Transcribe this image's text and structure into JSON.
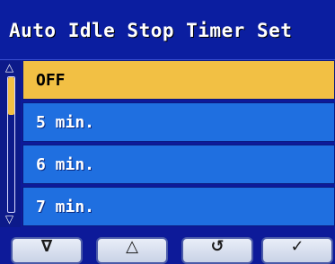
{
  "header": {
    "title": "Auto Idle Stop Timer Set"
  },
  "scroll": {
    "up_icon": "△",
    "down_icon": "▽"
  },
  "list": {
    "items": [
      {
        "label": "OFF",
        "selected": true
      },
      {
        "label": "5 min.",
        "selected": false
      },
      {
        "label": "6 min.",
        "selected": false
      },
      {
        "label": "7 min.",
        "selected": false
      }
    ]
  },
  "softkeys": {
    "down": "∇",
    "up": "△",
    "back": "↺",
    "ok": "✓"
  },
  "colors": {
    "header_bg": "#0b1ea0",
    "row_bg": "#1f6fe0",
    "selected_bg": "#f2c044"
  }
}
